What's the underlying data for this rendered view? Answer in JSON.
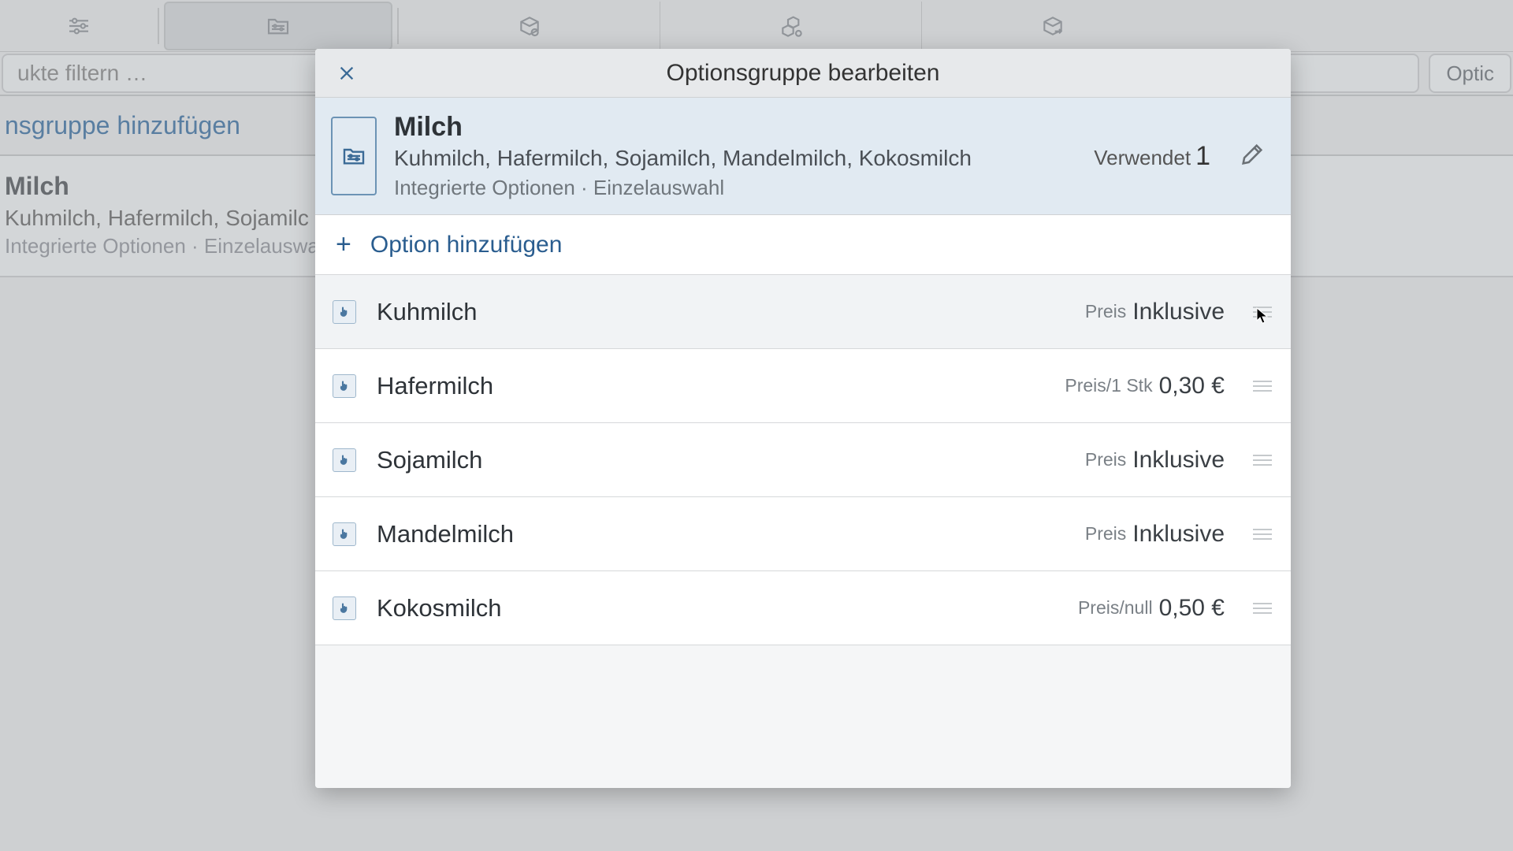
{
  "toolbar": {},
  "filter": {
    "placeholder": "ukte filtern …"
  },
  "opt_button": "Optic",
  "add_group_link": "nsgruppe hinzufügen",
  "bg_card": {
    "title": "Milch",
    "sub": "Kuhmilch, Hafermilch, Sojamilc",
    "meta": "Integrierte Optionen · Einzelauswah"
  },
  "modal": {
    "title": "Optionsgruppe bearbeiten",
    "group": {
      "name": "Milch",
      "items": "Kuhmilch, Hafermilch, Sojamilch, Mandelmilch, Kokosmilch",
      "meta": "Integrierte Optionen · Einzelauswahl",
      "used_label": "Verwendet",
      "used_count": "1"
    },
    "add_option": "Option hinzufügen",
    "options": [
      {
        "name": "Kuhmilch",
        "price_label": "Preis",
        "price_value": "Inklusive"
      },
      {
        "name": "Hafermilch",
        "price_label": "Preis/1 Stk",
        "price_value": "0,30 €"
      },
      {
        "name": "Sojamilch",
        "price_label": "Preis",
        "price_value": "Inklusive"
      },
      {
        "name": "Mandelmilch",
        "price_label": "Preis",
        "price_value": "Inklusive"
      },
      {
        "name": "Kokosmilch",
        "price_label": "Preis/null",
        "price_value": "0,50 €"
      }
    ]
  }
}
